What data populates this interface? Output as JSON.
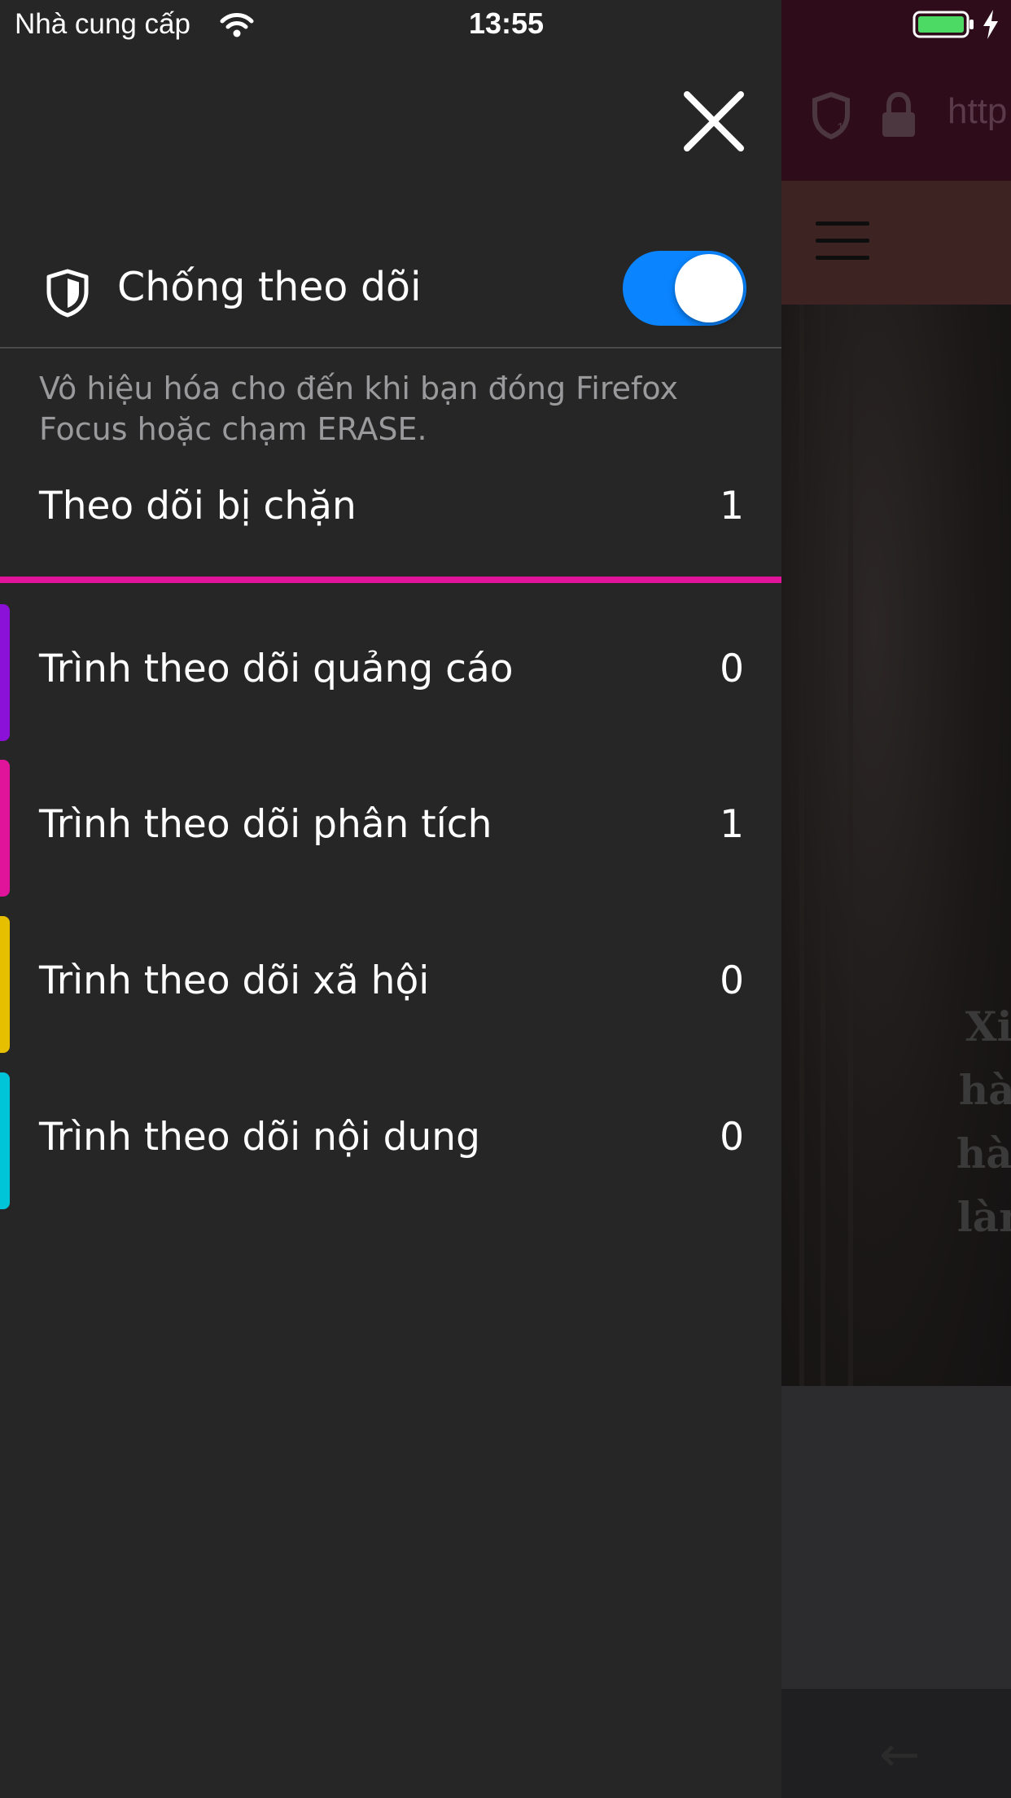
{
  "status_bar": {
    "carrier": "Nhà cung cấp",
    "time": "13:55"
  },
  "panel": {
    "title": "Chống theo dõi",
    "toggle_on": true,
    "description": "Vô hiệu hóa cho đến khi bạn đóng Firefox Focus hoặc chạm ERASE.",
    "blocked_label": "Theo dõi bị chặn",
    "blocked_count": "1",
    "accent_color": "#e0139b",
    "trackers": [
      {
        "label": "Trình theo dõi quảng cáo",
        "count": "0",
        "color": "#8b10d8"
      },
      {
        "label": "Trình theo dõi phân tích",
        "count": "1",
        "color": "#e0139b"
      },
      {
        "label": "Trình theo dõi xã hội",
        "count": "0",
        "color": "#e6bf00"
      },
      {
        "label": "Trình theo dõi nội dung",
        "count": "0",
        "color": "#00c4d8"
      }
    ]
  },
  "background": {
    "url_text": "http",
    "hero_lines": [
      "Xin",
      "hào",
      "hàn",
      "làm"
    ]
  }
}
